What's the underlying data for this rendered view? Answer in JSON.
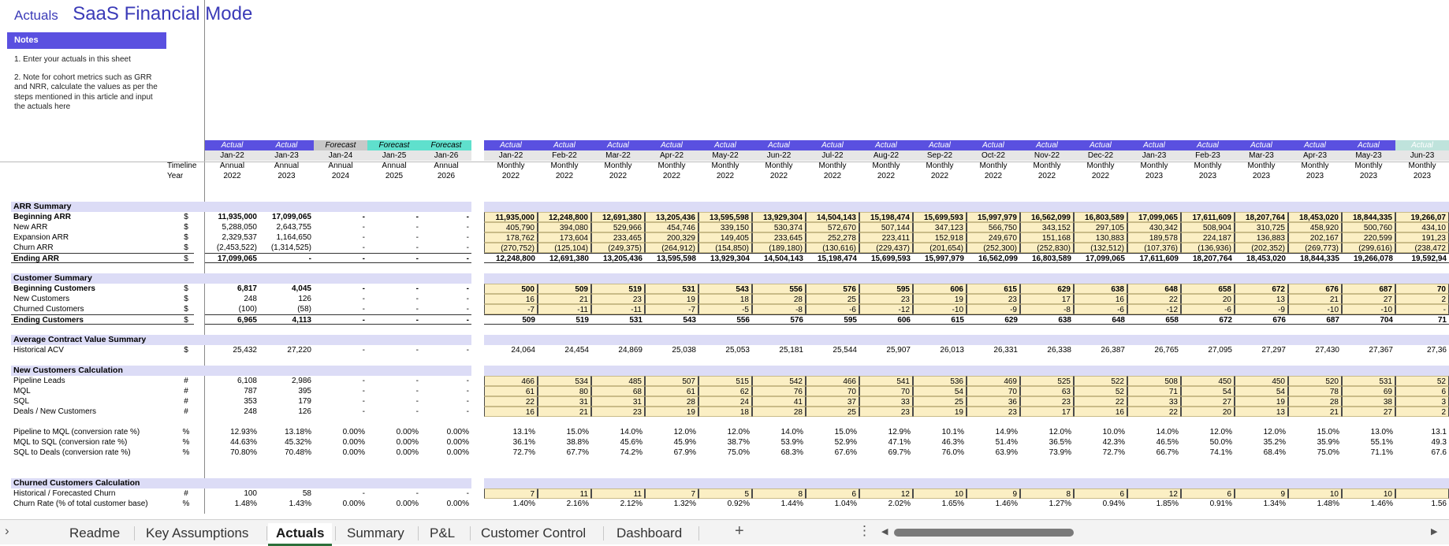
{
  "header": {
    "breadcrumb": "Actuals",
    "title": "SaaS Financial Mode"
  },
  "notes": {
    "title": "Notes",
    "line1": "1. Enter your actuals in this sheet",
    "line2": "2. Note for cohort metrics such as GRR and NRR, calculate the values as per the steps mentioned in this article and input the actuals here"
  },
  "labels": {
    "timeline": "Timeline",
    "year": "Year"
  },
  "annual_headers": [
    {
      "status": "Actual",
      "period": "Jan-22",
      "timeline": "Annual",
      "year": "2022",
      "color": "#5a50e0"
    },
    {
      "status": "Actual",
      "period": "Jan-23",
      "timeline": "Annual",
      "year": "2023",
      "color": "#5a50e0"
    },
    {
      "status": "Forecast",
      "period": "Jan-24",
      "timeline": "Annual",
      "year": "2024",
      "color": "#c8c8c8"
    },
    {
      "status": "Forecast",
      "period": "Jan-25",
      "timeline": "Annual",
      "year": "2025",
      "color": "#5fe0cd"
    },
    {
      "status": "Forecast",
      "period": "Jan-26",
      "timeline": "Annual",
      "year": "2026",
      "color": "#5fe0cd"
    }
  ],
  "monthly_headers": [
    {
      "status": "Actual",
      "period": "Jan-22",
      "timeline": "Monthly",
      "year": "2022"
    },
    {
      "status": "Actual",
      "period": "Feb-22",
      "timeline": "Monthly",
      "year": "2022"
    },
    {
      "status": "Actual",
      "period": "Mar-22",
      "timeline": "Monthly",
      "year": "2022"
    },
    {
      "status": "Actual",
      "period": "Apr-22",
      "timeline": "Monthly",
      "year": "2022"
    },
    {
      "status": "Actual",
      "period": "May-22",
      "timeline": "Monthly",
      "year": "2022"
    },
    {
      "status": "Actual",
      "period": "Jun-22",
      "timeline": "Monthly",
      "year": "2022"
    },
    {
      "status": "Actual",
      "period": "Jul-22",
      "timeline": "Monthly",
      "year": "2022"
    },
    {
      "status": "Actual",
      "period": "Aug-22",
      "timeline": "Monthly",
      "year": "2022"
    },
    {
      "status": "Actual",
      "period": "Sep-22",
      "timeline": "Monthly",
      "year": "2022"
    },
    {
      "status": "Actual",
      "period": "Oct-22",
      "timeline": "Monthly",
      "year": "2022"
    },
    {
      "status": "Actual",
      "period": "Nov-22",
      "timeline": "Monthly",
      "year": "2022"
    },
    {
      "status": "Actual",
      "period": "Dec-22",
      "timeline": "Monthly",
      "year": "2022"
    },
    {
      "status": "Actual",
      "period": "Jan-23",
      "timeline": "Monthly",
      "year": "2023"
    },
    {
      "status": "Actual",
      "period": "Feb-23",
      "timeline": "Monthly",
      "year": "2023"
    },
    {
      "status": "Actual",
      "period": "Mar-23",
      "timeline": "Monthly",
      "year": "2023"
    },
    {
      "status": "Actual",
      "period": "Apr-23",
      "timeline": "Monthly",
      "year": "2023"
    },
    {
      "status": "Actual",
      "period": "May-23",
      "timeline": "Monthly",
      "year": "2023"
    },
    {
      "status": "Actual",
      "period": "Jun-23",
      "timeline": "Monthly",
      "year": "2023"
    }
  ],
  "monthly_header_colors": {
    "actual": "#5a50e0",
    "last": "#bfe3dc"
  },
  "sections": [
    {
      "title": "ARR Summary",
      "rows": [
        {
          "label": "Beginning ARR",
          "unit": "$",
          "bold": true,
          "annual": [
            "11,935,000",
            "17,099,065",
            "-",
            "-",
            "-"
          ],
          "monthly": [
            "11,935,000",
            "12,248,800",
            "12,691,380",
            "13,205,436",
            "13,595,598",
            "13,929,304",
            "14,504,143",
            "15,198,474",
            "15,699,593",
            "15,997,979",
            "16,562,099",
            "16,803,589",
            "17,099,065",
            "17,611,609",
            "18,207,764",
            "18,453,020",
            "18,844,335",
            "19,266,07"
          ]
        },
        {
          "label": "New ARR",
          "unit": "$",
          "annual": [
            "5,288,050",
            "2,643,755",
            "-",
            "-",
            "-"
          ],
          "monthly": [
            "405,790",
            "394,080",
            "529,966",
            "454,746",
            "339,150",
            "530,374",
            "572,670",
            "507,144",
            "347,123",
            "566,750",
            "343,152",
            "297,105",
            "430,342",
            "508,904",
            "310,725",
            "458,920",
            "500,760",
            "434,10"
          ]
        },
        {
          "label": "Expansion ARR",
          "unit": "$",
          "annual": [
            "2,329,537",
            "1,164,650",
            "-",
            "-",
            "-"
          ],
          "monthly": [
            "178,762",
            "173,604",
            "233,465",
            "200,329",
            "149,405",
            "233,645",
            "252,278",
            "223,411",
            "152,918",
            "249,670",
            "151,168",
            "130,883",
            "189,578",
            "224,187",
            "136,883",
            "202,167",
            "220,599",
            "191,23"
          ]
        },
        {
          "label": "Churn ARR",
          "unit": "$",
          "annual": [
            "(2,453,522)",
            "(1,314,525)",
            "-",
            "-",
            "-"
          ],
          "monthly": [
            "(270,752)",
            "(125,104)",
            "(249,375)",
            "(264,912)",
            "(154,850)",
            "(189,180)",
            "(130,616)",
            "(229,437)",
            "(201,654)",
            "(252,300)",
            "(252,830)",
            "(132,512)",
            "(107,376)",
            "(136,936)",
            "(202,352)",
            "(269,773)",
            "(299,616)",
            "(238,472"
          ]
        },
        {
          "label": "Ending ARR",
          "unit": "$",
          "bold": true,
          "total": true,
          "annual": [
            "17,099,065",
            "-",
            "-",
            "-",
            "-"
          ],
          "monthly": [
            "12,248,800",
            "12,691,380",
            "13,205,436",
            "13,595,598",
            "13,929,304",
            "14,504,143",
            "15,198,474",
            "15,699,593",
            "15,997,979",
            "16,562,099",
            "16,803,589",
            "17,099,065",
            "17,611,609",
            "18,207,764",
            "18,453,020",
            "18,844,335",
            "19,266,078",
            "19,592,94"
          ]
        }
      ]
    },
    {
      "title": "Customer Summary",
      "rows": [
        {
          "label": "Beginning Customers",
          "unit": "$",
          "bold": true,
          "annual": [
            "6,817",
            "4,045",
            "-",
            "-",
            "-"
          ],
          "monthly": [
            "500",
            "509",
            "519",
            "531",
            "543",
            "556",
            "576",
            "595",
            "606",
            "615",
            "629",
            "638",
            "648",
            "658",
            "672",
            "676",
            "687",
            "70"
          ]
        },
        {
          "label": "New Customers",
          "unit": "$",
          "annual": [
            "248",
            "126",
            "-",
            "-",
            "-"
          ],
          "monthly": [
            "16",
            "21",
            "23",
            "19",
            "18",
            "28",
            "25",
            "23",
            "19",
            "23",
            "17",
            "16",
            "22",
            "20",
            "13",
            "21",
            "27",
            "2"
          ]
        },
        {
          "label": "Churned Customers",
          "unit": "$",
          "annual": [
            "(100)",
            "(58)",
            "-",
            "-",
            "-"
          ],
          "monthly": [
            "-7",
            "-11",
            "-11",
            "-7",
            "-5",
            "-8",
            "-6",
            "-12",
            "-10",
            "-9",
            "-8",
            "-6",
            "-12",
            "-6",
            "-9",
            "-10",
            "-10",
            "-"
          ]
        },
        {
          "label": "Ending Customers",
          "unit": "$",
          "bold": true,
          "total": true,
          "annual": [
            "6,965",
            "4,113",
            "-",
            "-",
            "-"
          ],
          "monthly": [
            "509",
            "519",
            "531",
            "543",
            "556",
            "576",
            "595",
            "606",
            "615",
            "629",
            "638",
            "648",
            "658",
            "672",
            "676",
            "687",
            "704",
            "71"
          ]
        }
      ]
    },
    {
      "title": "Average Contract Value Summary",
      "rows": [
        {
          "label": "Historical ACV",
          "unit": "$",
          "plain": true,
          "annual": [
            "25,432",
            "27,220",
            "-",
            "-",
            "-"
          ],
          "monthly": [
            "24,064",
            "24,454",
            "24,869",
            "25,038",
            "25,053",
            "25,181",
            "25,544",
            "25,907",
            "26,013",
            "26,331",
            "26,338",
            "26,387",
            "26,765",
            "27,095",
            "27,297",
            "27,430",
            "27,367",
            "27,36"
          ]
        }
      ]
    },
    {
      "title": "New Customers Calculation",
      "rows": [
        {
          "label": "Pipeline Leads",
          "unit": "#",
          "annual": [
            "6,108",
            "2,986",
            "-",
            "-",
            "-"
          ],
          "monthly": [
            "466",
            "534",
            "485",
            "507",
            "515",
            "542",
            "466",
            "541",
            "536",
            "469",
            "525",
            "522",
            "508",
            "450",
            "450",
            "520",
            "531",
            "52"
          ]
        },
        {
          "label": "MQL",
          "unit": "#",
          "annual": [
            "787",
            "395",
            "-",
            "-",
            "-"
          ],
          "monthly": [
            "61",
            "80",
            "68",
            "61",
            "62",
            "76",
            "70",
            "70",
            "54",
            "70",
            "63",
            "52",
            "71",
            "54",
            "54",
            "78",
            "69",
            "6"
          ]
        },
        {
          "label": "SQL",
          "unit": "#",
          "annual": [
            "353",
            "179",
            "-",
            "-",
            "-"
          ],
          "monthly": [
            "22",
            "31",
            "31",
            "28",
            "24",
            "41",
            "37",
            "33",
            "25",
            "36",
            "23",
            "22",
            "33",
            "27",
            "19",
            "28",
            "38",
            "3"
          ]
        },
        {
          "label": "Deals / New Customers",
          "unit": "#",
          "annual": [
            "248",
            "126",
            "-",
            "-",
            "-"
          ],
          "monthly": [
            "16",
            "21",
            "23",
            "19",
            "18",
            "28",
            "25",
            "23",
            "19",
            "23",
            "17",
            "16",
            "22",
            "20",
            "13",
            "21",
            "27",
            "2"
          ]
        },
        {
          "label": "Pipeline to MQL (conversion rate %)",
          "unit": "%",
          "plain": true,
          "gap": true,
          "annual": [
            "12.93%",
            "13.18%",
            "0.00%",
            "0.00%",
            "0.00%"
          ],
          "monthly": [
            "13.1%",
            "15.0%",
            "14.0%",
            "12.0%",
            "12.0%",
            "14.0%",
            "15.0%",
            "12.9%",
            "10.1%",
            "14.9%",
            "12.0%",
            "10.0%",
            "14.0%",
            "12.0%",
            "12.0%",
            "15.0%",
            "13.0%",
            "13.1"
          ]
        },
        {
          "label": "MQL to SQL (conversion rate %)",
          "unit": "%",
          "plain": true,
          "annual": [
            "44.63%",
            "45.32%",
            "0.00%",
            "0.00%",
            "0.00%"
          ],
          "monthly": [
            "36.1%",
            "38.8%",
            "45.6%",
            "45.9%",
            "38.7%",
            "53.9%",
            "52.9%",
            "47.1%",
            "46.3%",
            "51.4%",
            "36.5%",
            "42.3%",
            "46.5%",
            "50.0%",
            "35.2%",
            "35.9%",
            "55.1%",
            "49.3"
          ]
        },
        {
          "label": "SQL to Deals (conversion rate %)",
          "unit": "%",
          "plain": true,
          "annual": [
            "70.80%",
            "70.48%",
            "0.00%",
            "0.00%",
            "0.00%"
          ],
          "monthly": [
            "72.7%",
            "67.7%",
            "74.2%",
            "67.9%",
            "75.0%",
            "68.3%",
            "67.6%",
            "69.7%",
            "76.0%",
            "63.9%",
            "73.9%",
            "72.7%",
            "66.7%",
            "74.1%",
            "68.4%",
            "75.0%",
            "71.1%",
            "67.6"
          ]
        }
      ]
    },
    {
      "title": "Churned Customers Calculation",
      "rows": [
        {
          "label": "Historical / Forecasted Churn",
          "unit": "#",
          "annual": [
            "100",
            "58",
            "-",
            "-",
            "-"
          ],
          "monthly": [
            "7",
            "11",
            "11",
            "7",
            "5",
            "8",
            "6",
            "12",
            "10",
            "9",
            "8",
            "6",
            "12",
            "6",
            "9",
            "10",
            "10",
            ""
          ]
        },
        {
          "label": "Churn Rate (% of total customer base)",
          "unit": "%",
          "plain": true,
          "annual": [
            "1.48%",
            "1.43%",
            "0.00%",
            "0.00%",
            "0.00%"
          ],
          "monthly": [
            "1.40%",
            "2.16%",
            "2.12%",
            "1.32%",
            "0.92%",
            "1.44%",
            "1.04%",
            "2.02%",
            "1.65%",
            "1.46%",
            "1.27%",
            "0.94%",
            "1.85%",
            "0.91%",
            "1.34%",
            "1.48%",
            "1.46%",
            "1.56"
          ]
        }
      ]
    }
  ],
  "tabs": [
    {
      "label": "Readme"
    },
    {
      "label": "Key Assumptions"
    },
    {
      "label": "Actuals",
      "active": true
    },
    {
      "label": "Summary"
    },
    {
      "label": "P&L"
    },
    {
      "label": "Customer Control"
    },
    {
      "label": "Dashboard"
    }
  ],
  "tabbar": {
    "add_symbol": "+",
    "more_symbol": "⋮",
    "prev_symbol": "◀",
    "next_symbol": "▶",
    "nav_symbol": "›"
  }
}
